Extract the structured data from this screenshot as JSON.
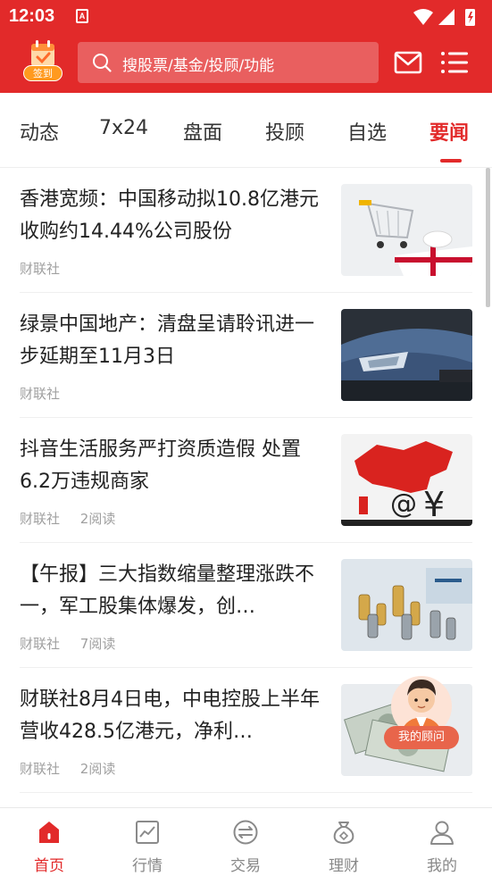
{
  "status_bar": {
    "time": "12:03",
    "app_badge": "A"
  },
  "header": {
    "signin_label": "签到",
    "search_placeholder": "搜股票/基金/投顾/功能",
    "accent_color": "#e22a2a"
  },
  "tabs": [
    {
      "label": "动态"
    },
    {
      "label": "7x24"
    },
    {
      "label": "盘面"
    },
    {
      "label": "投顾"
    },
    {
      "label": "自选"
    },
    {
      "label": "要闻",
      "active": true
    }
  ],
  "news": [
    {
      "title": "香港宽频：中国移动拟10.8亿港元收购约14.44%公司股份",
      "source": "财联社",
      "reads": "",
      "thumb": "shopping-cart-gift-image"
    },
    {
      "title": "绿景中国地产：清盘呈请聆讯进一步延期至11月3日",
      "source": "财联社",
      "reads": "",
      "thumb": "car-headlight-image"
    },
    {
      "title": "抖音生活服务严打资质造假 处置6.2万违规商家",
      "source": "财联社",
      "reads": "2阅读",
      "thumb": "china-map-ecommerce-image"
    },
    {
      "title": "【午报】三大指数缩量整理涨跌不一，军工股集体爆发，创…",
      "source": "财联社",
      "reads": "7阅读",
      "thumb": "chess-pieces-image"
    },
    {
      "title": "财联社8月4日电，中电控股上半年营收428.5亿港元，净利…",
      "source": "财联社",
      "reads": "2阅读",
      "thumb": "dollar-bills-image"
    }
  ],
  "advisor": {
    "label": "我的顾问"
  },
  "bottom_nav": [
    {
      "label": "首页",
      "icon": "home-icon",
      "active": true
    },
    {
      "label": "行情",
      "icon": "chart-icon"
    },
    {
      "label": "交易",
      "icon": "exchange-icon"
    },
    {
      "label": "理财",
      "icon": "money-bag-icon"
    },
    {
      "label": "我的",
      "icon": "user-icon"
    }
  ]
}
